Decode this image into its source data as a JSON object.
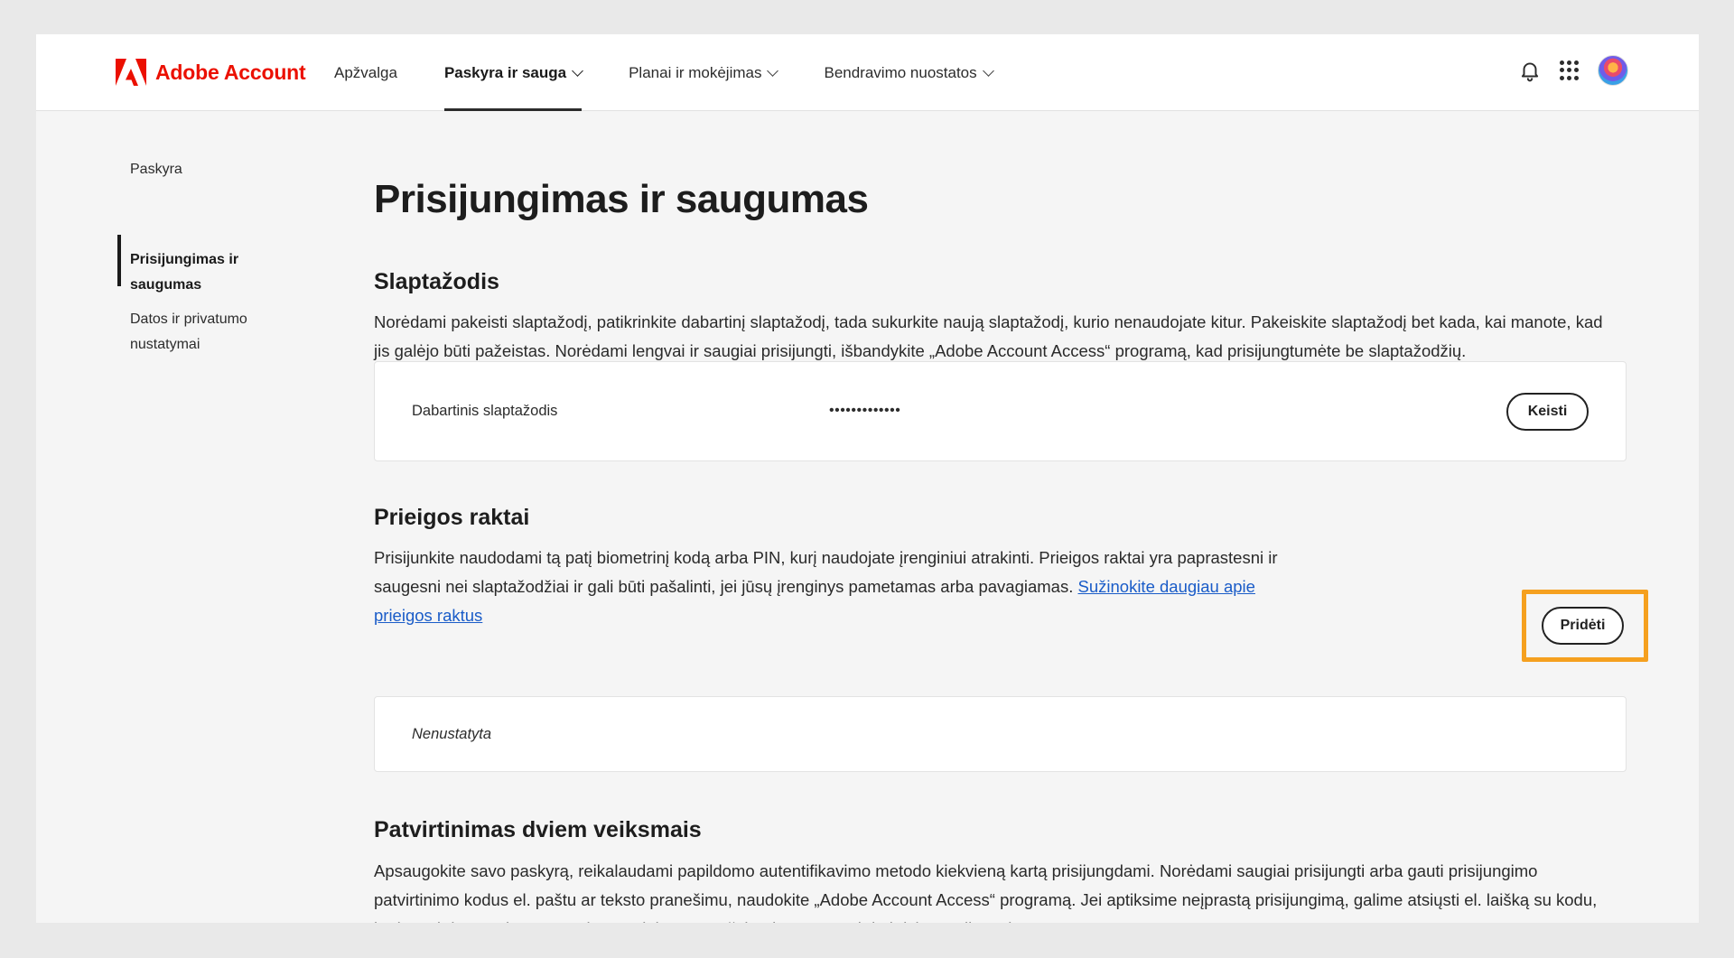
{
  "header": {
    "brand": "Adobe Account",
    "nav": [
      {
        "label": "Apžvalga",
        "dropdown": false,
        "active": false
      },
      {
        "label": "Paskyra ir sauga",
        "dropdown": true,
        "active": true
      },
      {
        "label": "Planai ir mokėjimas",
        "dropdown": true,
        "active": false
      },
      {
        "label": "Bendravimo nuostatos",
        "dropdown": true,
        "active": false
      }
    ],
    "icons": [
      "bell-icon",
      "apps-grid-icon",
      "avatar"
    ]
  },
  "sidebar": {
    "items": [
      {
        "label": "Paskyra",
        "active": false
      },
      {
        "label": "Prisijungimas ir saugumas",
        "active": true
      },
      {
        "label": "Datos ir privatumo nustatymai",
        "active": false
      }
    ]
  },
  "main": {
    "title": "Prisijungimas ir saugumas",
    "password": {
      "title": "Slaptažodis",
      "description_line1": "Norėdami pakeisti slaptažodį, patikrinkite dabartinį slaptažodį, tada sukurkite naują slaptažodį, kurio nenaudojate kitur. Pakeiskite slaptažodį bet kada, kai manote, kad",
      "description_line2": "jis galėjo būti pažeistas. Norėdami lengvai ir saugiai prisijungti, išbandykite „Adobe Account Access“ programą, kad prisijungtumėte be slaptažodžių.",
      "current_label": "Dabartinis slaptažodis",
      "current_value": "•••••••••••••",
      "change_button": "Keisti"
    },
    "passkeys": {
      "title": "Prieigos raktai",
      "description_line1": "Prisijunkite naudodami tą patį biometrinį kodą arba PIN, kurį naudojate įrenginiui atrakinti. Prieigos raktai yra paprastesni ir",
      "description_line2": "saugesni nei slaptažodžiai ir gali būti pašalinti, jei jūsų įrenginys pametamas arba pavagiamas.",
      "link_part1": "Sužinokite daugiau apie",
      "link_part2": "prieigos raktus",
      "add_button": "Pridėti",
      "status": "Nenustatyta",
      "highlight_color": "#f5a01f"
    },
    "two_step": {
      "title": "Patvirtinimas dviem veiksmais",
      "description_line1": "Apsaugokite savo paskyrą, reikalaudami papildomo autentifikavimo metodo kiekvieną kartą prisijungdami. Norėdami saugiai prisijungti arba gauti prisijungimo",
      "description_line2": "patvirtinimo kodus el. paštu ar teksto pranešimu, naudokite „Adobe Account Access“ programą. Jei aptiksime neįprastą prisijungimą, galime atsiųsti el. laišką su kodu,",
      "description_line3": "kad patvirtintume jūsų tapatybę, net jei nesate užsiregistravę patvirtinti dviem veiksmais."
    }
  },
  "colors": {
    "brand_red": "#eb1000",
    "link_blue": "#1a5cc8",
    "highlight_orange": "#f5a01f"
  }
}
